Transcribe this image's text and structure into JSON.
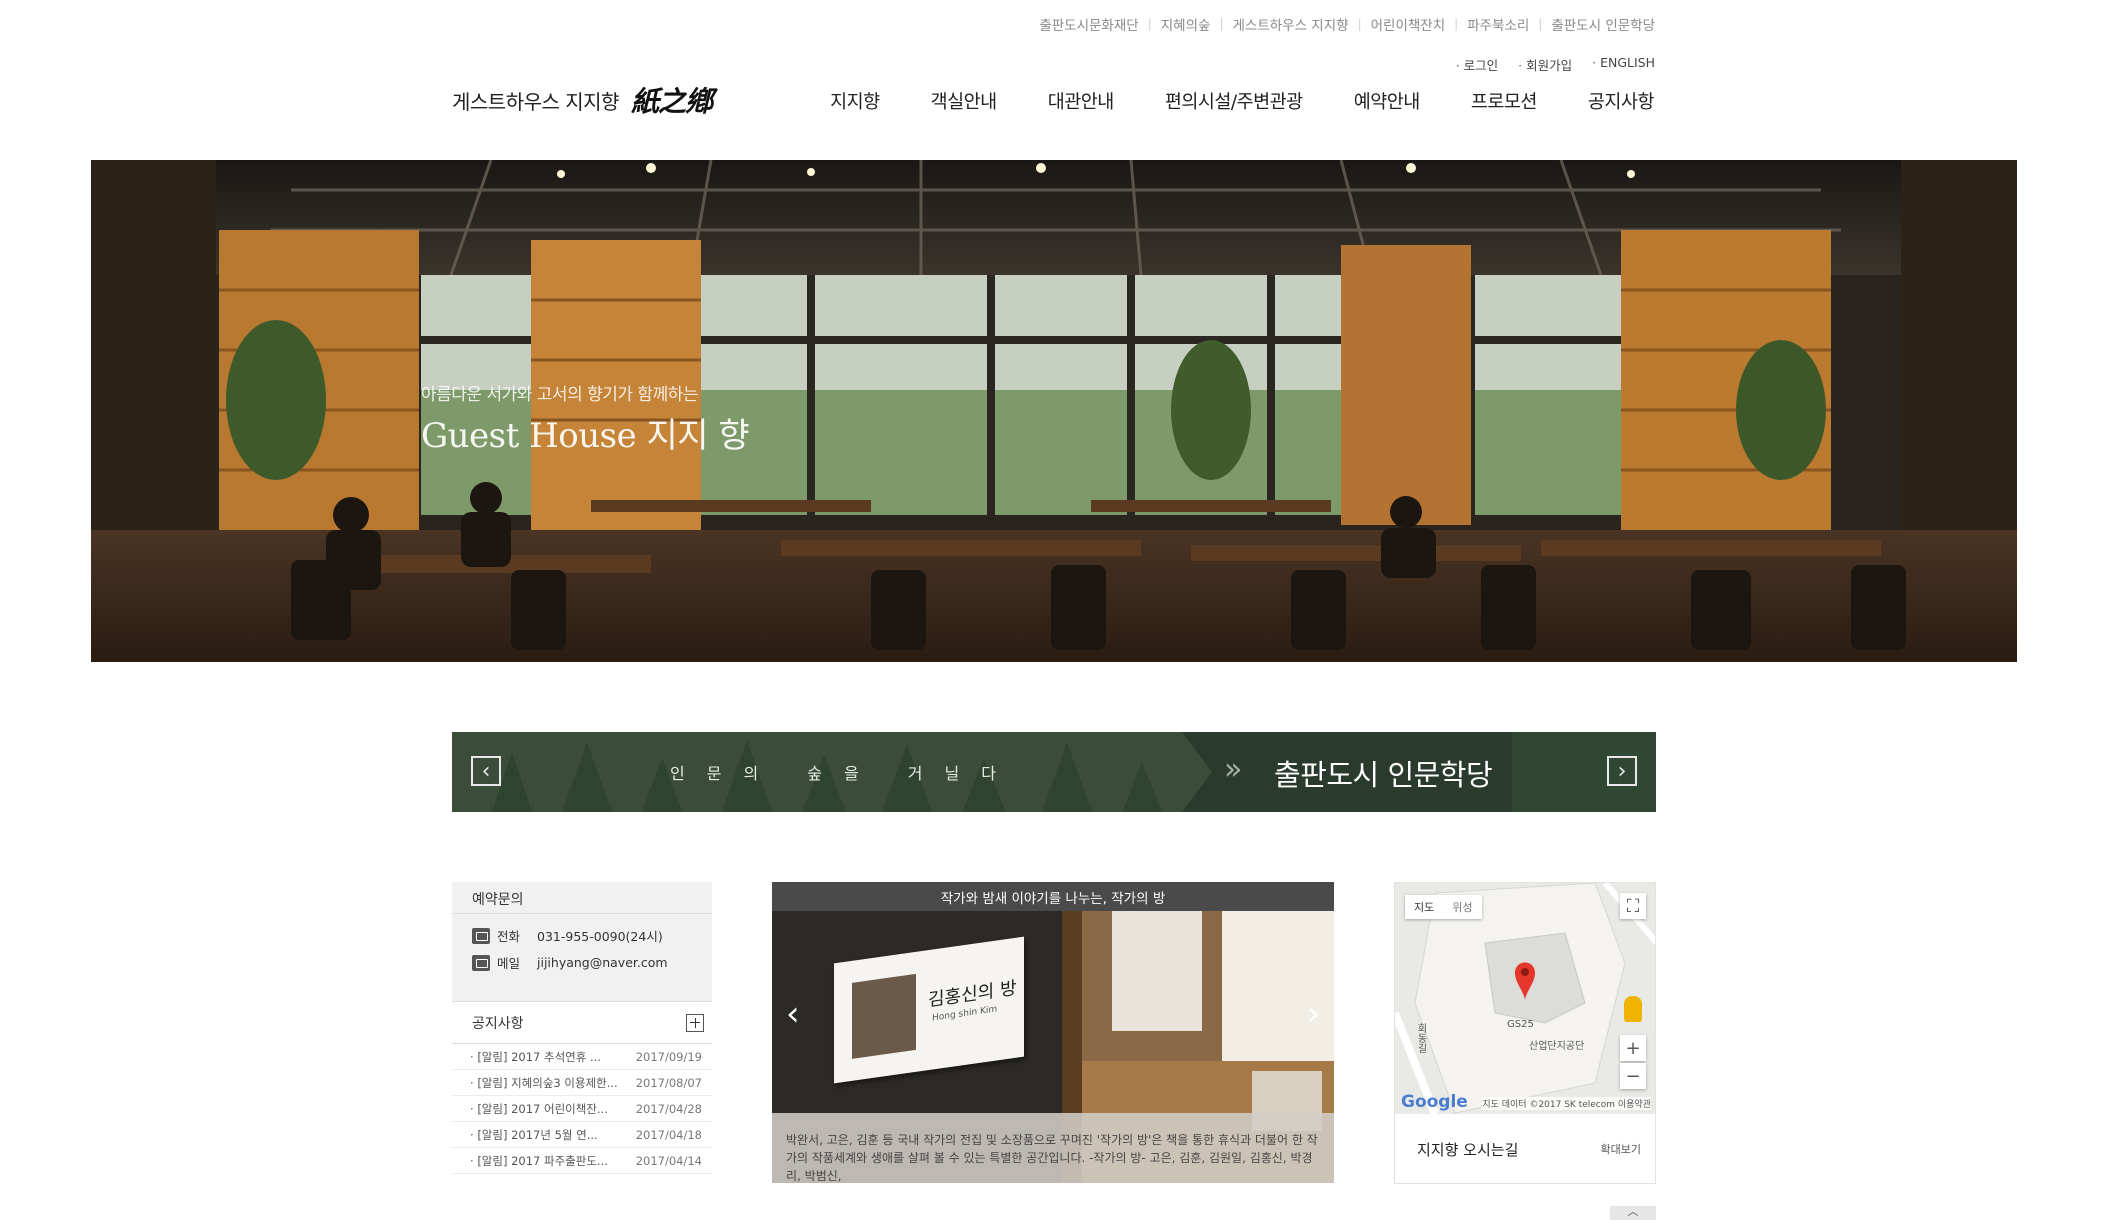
{
  "util_links": [
    "출판도시문화재단",
    "지혜의숲",
    "게스트하우스 지지향",
    "어린이책잔치",
    "파주북소리",
    "출판도시 인문학당"
  ],
  "member_links": [
    "로그인",
    "회원가입",
    "ENGLISH"
  ],
  "logo": {
    "text": "게스트하우스 지지향",
    "hanja": "紙之鄕"
  },
  "nav": [
    "지지향",
    "객실안내",
    "대관안내",
    "편의시설/주변관광",
    "예약안내",
    "프로모션",
    "공지사항"
  ],
  "hero": {
    "subtitle": "아름다운 서가와 고서의 향기가 함께하는",
    "title": "Guest House 지지 향"
  },
  "banner": {
    "phrase": "인문의 숲을 거닐다",
    "chevrons": "»",
    "title": "출판도시 인문학당"
  },
  "contact": {
    "title": "예약문의",
    "phone_label": "전화",
    "phone": "031-955-0090(24시)",
    "mail_label": "메일",
    "mail": "jijihyang@naver.com"
  },
  "notices": {
    "title": "공지사항",
    "items": [
      {
        "title": "[알림] 2017 추석연휴 ...",
        "date": "2017/09/19"
      },
      {
        "title": "[알림] 지혜의숲3 이용제한...",
        "date": "2017/08/07"
      },
      {
        "title": "[알림] 2017 어린이책잔...",
        "date": "2017/04/28"
      },
      {
        "title": "[알림] 2017년 5월 연...",
        "date": "2017/04/18"
      },
      {
        "title": "[알림] 2017 파주출판도...",
        "date": "2017/04/14"
      }
    ]
  },
  "writer_room": {
    "title": "작가와 밤새 이야기를 나누는, 작가의 방",
    "nameplate": "김홍신의 방",
    "nameplate_en": "Hong shin Kim",
    "caption": "박완서, 고은, 김훈 등 국내 작가의 전집 및 소장품으로 꾸며진 '작가의 방'은 책을 통한 휴식과 더불어 한 작가의 작품세계와 생애를 살펴 볼 수 있는 특별한 공간입니다. -작가의 방- 고은, 김훈, 김원일, 김홍신, 박경리, 박범신,"
  },
  "map": {
    "tab_map": "지도",
    "tab_satellite": "위성",
    "label_gs25": "GS25",
    "label_complex": "산업단지공단",
    "label_road": "회동길",
    "google": "Google",
    "attribution": "지도 데이터 ©2017 SK telecom  이용약관",
    "footer_title": "지지향 오시는길",
    "zoom_link": "확대보기"
  }
}
